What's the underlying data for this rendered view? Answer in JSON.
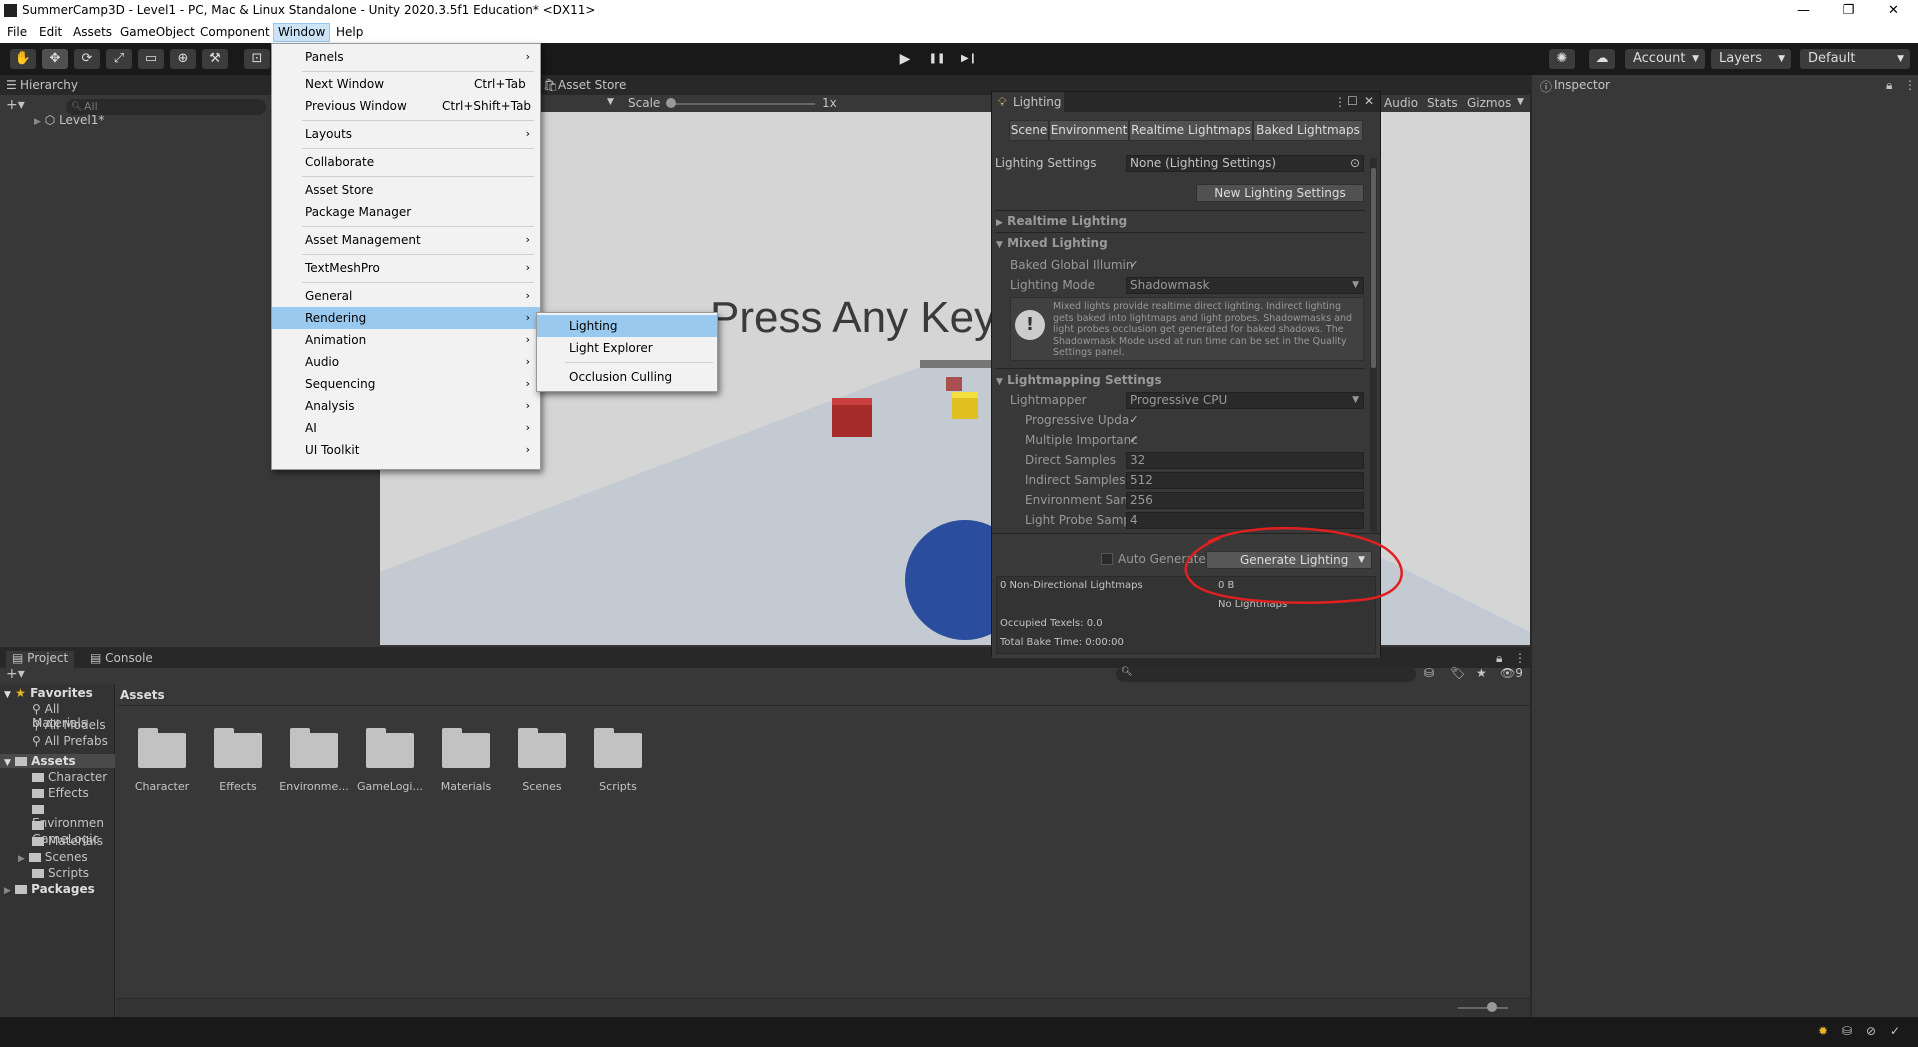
{
  "window": {
    "title": "SummerCamp3D - Level1 - PC, Mac & Linux Standalone - Unity 2020.3.5f1 Education* <DX11>"
  },
  "menubar": [
    "File",
    "Edit",
    "Assets",
    "GameObject",
    "Component",
    "Window",
    "Help"
  ],
  "toolbar": {
    "account": "Account",
    "layers": "Layers",
    "layout": "Default",
    "play": "▶",
    "pause": "❚❚",
    "step": "▶❙"
  },
  "hierarchy": {
    "tab": "Hierarchy",
    "search_placeholder": "All",
    "root": "Level1*"
  },
  "scene": {
    "asset_store_tab": "Asset Store",
    "scale_label": "Scale",
    "scale_value": "1x",
    "game_text": "Press Any Key",
    "audio": "Audio",
    "stats": "Stats",
    "gizmos": "Gizmos"
  },
  "window_menu": {
    "items": [
      {
        "label": "Panels",
        "shortcut": "",
        "arrow": true
      },
      {
        "label": "Next Window",
        "shortcut": "Ctrl+Tab",
        "arrow": false
      },
      {
        "label": "Previous Window",
        "shortcut": "Ctrl+Shift+Tab",
        "arrow": false
      },
      {
        "label": "Layouts",
        "shortcut": "",
        "arrow": true
      },
      {
        "label": "Collaborate",
        "shortcut": "",
        "arrow": false
      },
      {
        "label": "Asset Store",
        "shortcut": "",
        "arrow": false
      },
      {
        "label": "Package Manager",
        "shortcut": "",
        "arrow": false
      },
      {
        "label": "Asset Management",
        "shortcut": "",
        "arrow": true
      },
      {
        "label": "TextMeshPro",
        "shortcut": "",
        "arrow": true
      },
      {
        "label": "General",
        "shortcut": "",
        "arrow": true
      },
      {
        "label": "Rendering",
        "shortcut": "",
        "arrow": true
      },
      {
        "label": "Animation",
        "shortcut": "",
        "arrow": true
      },
      {
        "label": "Audio",
        "shortcut": "",
        "arrow": true
      },
      {
        "label": "Sequencing",
        "shortcut": "",
        "arrow": true
      },
      {
        "label": "Analysis",
        "shortcut": "",
        "arrow": true
      },
      {
        "label": "AI",
        "shortcut": "",
        "arrow": true
      },
      {
        "label": "UI Toolkit",
        "shortcut": "",
        "arrow": true
      }
    ],
    "highlighted": "Rendering"
  },
  "rendering_submenu": {
    "items": [
      "Lighting",
      "Light Explorer",
      "Occlusion Culling"
    ],
    "highlighted": "Lighting"
  },
  "lighting": {
    "title": "Lighting",
    "tabs": [
      "Scene",
      "Environment",
      "Realtime Lightmaps",
      "Baked Lightmaps"
    ],
    "settings_label": "Lighting Settings",
    "settings_value": "None (Lighting Settings)",
    "new_settings_button": "New Lighting Settings",
    "realtime_section": "Realtime Lighting",
    "mixed_section": "Mixed Lighting",
    "baked_gi_label": "Baked Global Illumin",
    "lighting_mode_label": "Lighting Mode",
    "lighting_mode_value": "Shadowmask",
    "info_text": "Mixed lights provide realtime direct lighting. Indirect lighting gets baked into lightmaps and light probes. Shadowmasks and light probes occlusion get generated for baked shadows. The Shadowmask Mode used at run time can be set in the Quality Settings panel.",
    "lightmapping_section": "Lightmapping Settings",
    "lightmapper_label": "Lightmapper",
    "lightmapper_value": "Progressive CPU",
    "progressive_label": "Progressive Upda",
    "multiple_label": "Multiple Importanc",
    "direct_label": "Direct Samples",
    "direct_value": "32",
    "indirect_label": "Indirect Samples",
    "indirect_value": "512",
    "env_label": "Environment Sam",
    "env_value": "256",
    "probe_label": "Light Probe Samp",
    "probe_value": "4",
    "auto_generate": "Auto Generate",
    "generate_button": "Generate Lighting",
    "stats_lightmaps": "0 Non-Directional Lightmaps",
    "stats_size": "0 B",
    "no_lightmaps": "No Lightmaps",
    "occupied": "Occupied Texels: 0.0",
    "bake_time": "Total Bake Time: 0:00:00",
    "highlight_color": "#e02020"
  },
  "inspector": {
    "tab": "Inspector"
  },
  "project": {
    "tabs": [
      "Project",
      "Console"
    ],
    "favorites": "Favorites",
    "fav_items": [
      "All Materials",
      "All Models",
      "All Prefabs"
    ],
    "assets_root": "Assets",
    "tree_items": [
      "Character",
      "Effects",
      "Environmen",
      "GameLogic",
      "Materials",
      "Scenes",
      "Scripts"
    ],
    "packages": "Packages",
    "breadcrumb": "Assets",
    "folders": [
      "Character",
      "Effects",
      "Environme...",
      "GameLogi...",
      "Materials",
      "Scenes",
      "Scripts"
    ],
    "hidden_count": "9"
  }
}
